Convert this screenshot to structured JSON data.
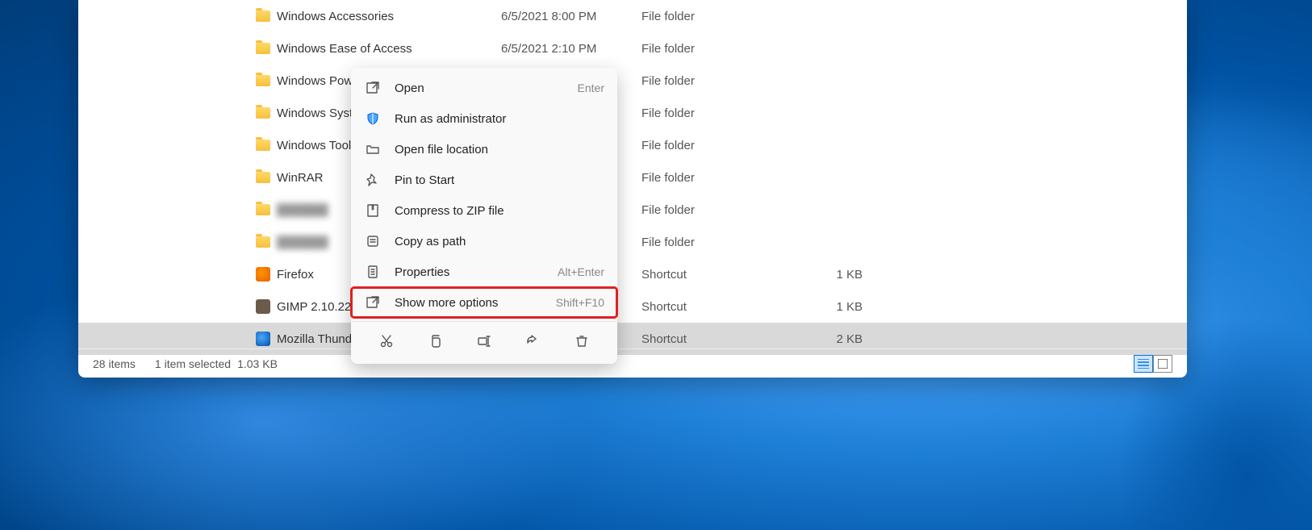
{
  "files": [
    {
      "icon": "folder",
      "name": "Windows Accessories",
      "date": "6/5/2021 8:00 PM",
      "type": "File folder",
      "size": ""
    },
    {
      "icon": "folder",
      "name": "Windows Ease of Access",
      "date": "6/5/2021 2:10 PM",
      "type": "File folder",
      "size": ""
    },
    {
      "icon": "folder",
      "name": "Windows Power",
      "date": "",
      "type": "File folder",
      "size": ""
    },
    {
      "icon": "folder",
      "name": "Windows Syste",
      "date": "",
      "type": "File folder",
      "size": ""
    },
    {
      "icon": "folder",
      "name": "Windows Tools",
      "date": "",
      "type": "File folder",
      "size": ""
    },
    {
      "icon": "folder",
      "name": "WinRAR",
      "date": "",
      "type": "File folder",
      "size": ""
    },
    {
      "icon": "folder",
      "name": "",
      "date": "",
      "type": "File folder",
      "size": "",
      "blurred": true
    },
    {
      "icon": "folder",
      "name": "",
      "date": "",
      "type": "File folder",
      "size": "",
      "blurred": true
    },
    {
      "icon": "firefox",
      "name": "Firefox",
      "date": "",
      "type": "Shortcut",
      "size": "1 KB"
    },
    {
      "icon": "gimp",
      "name": "GIMP 2.10.22",
      "date": "",
      "type": "Shortcut",
      "size": "1 KB"
    },
    {
      "icon": "thunderbird",
      "name": "Mozilla Thunde",
      "date": "",
      "type": "Shortcut",
      "size": "2 KB",
      "selected": true
    }
  ],
  "context_menu": {
    "items": [
      {
        "icon": "open",
        "label": "Open",
        "shortcut": "Enter"
      },
      {
        "icon": "shield",
        "label": "Run as administrator",
        "shortcut": ""
      },
      {
        "icon": "folder-open",
        "label": "Open file location",
        "shortcut": ""
      },
      {
        "icon": "pin",
        "label": "Pin to Start",
        "shortcut": ""
      },
      {
        "icon": "zip",
        "label": "Compress to ZIP file",
        "shortcut": ""
      },
      {
        "icon": "copy-path",
        "label": "Copy as path",
        "shortcut": ""
      },
      {
        "icon": "properties",
        "label": "Properties",
        "shortcut": "Alt+Enter"
      },
      {
        "icon": "more",
        "label": "Show more options",
        "shortcut": "Shift+F10",
        "highlighted": true
      }
    ],
    "actions": [
      "cut",
      "copy",
      "rename",
      "share",
      "delete"
    ]
  },
  "statusbar": {
    "item_count": "28 items",
    "selection": "1 item selected",
    "size": "1.03 KB"
  }
}
